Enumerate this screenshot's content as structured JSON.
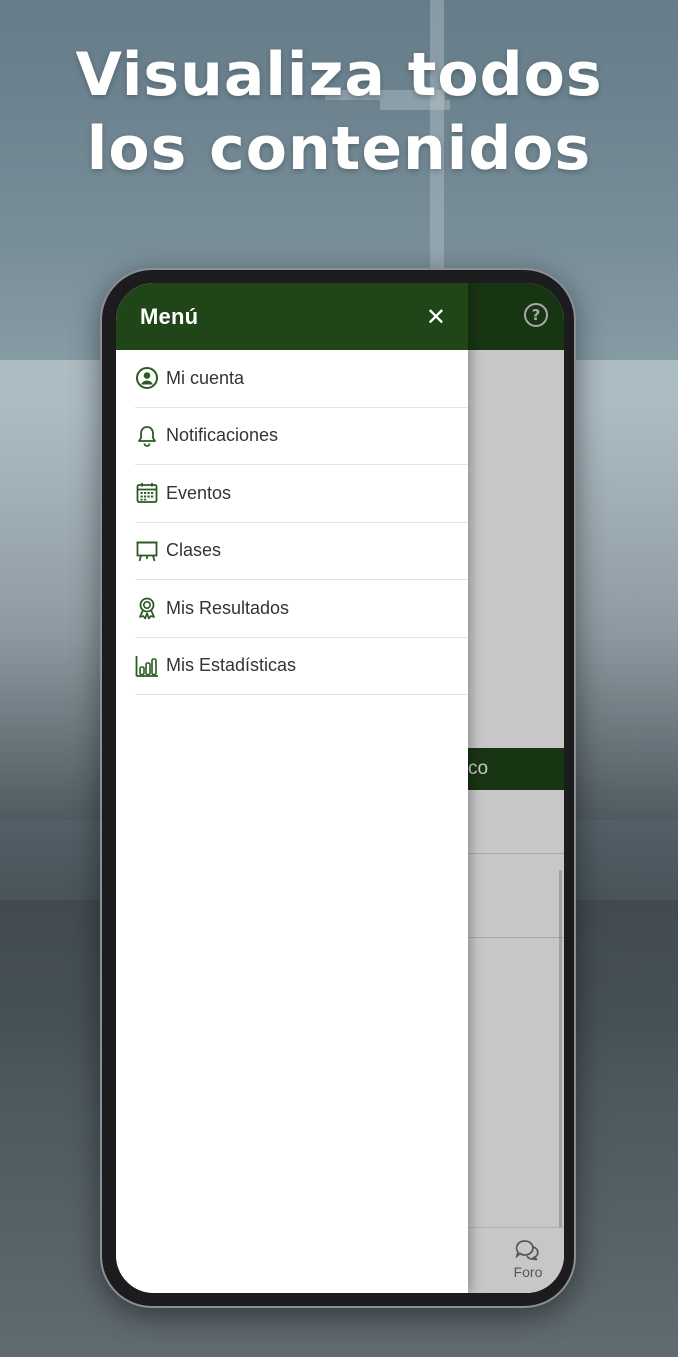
{
  "headline": {
    "line1": "Visualiza todos",
    "line2": "los contenidos"
  },
  "colors": {
    "brand_green": "#1f4519",
    "icon_green": "#2b5a23"
  },
  "app": {
    "green_bar_text": "co",
    "bottom_nav": {
      "foro_label": "Foro",
      "foro_icon": "chat-bubbles-icon"
    },
    "help_icon": "help-circle-icon",
    "help_glyph": "?"
  },
  "drawer": {
    "title": "Menú",
    "close_glyph": "✕",
    "items": [
      {
        "label": "Mi cuenta",
        "icon": "user-circle-icon"
      },
      {
        "label": "Notificaciones",
        "icon": "bell-icon"
      },
      {
        "label": "Eventos",
        "icon": "calendar-icon"
      },
      {
        "label": "Clases",
        "icon": "presentation-board-icon"
      },
      {
        "label": "Mis Resultados",
        "icon": "award-ribbon-icon"
      },
      {
        "label": "Mis Estadísticas",
        "icon": "bar-chart-icon"
      }
    ]
  }
}
